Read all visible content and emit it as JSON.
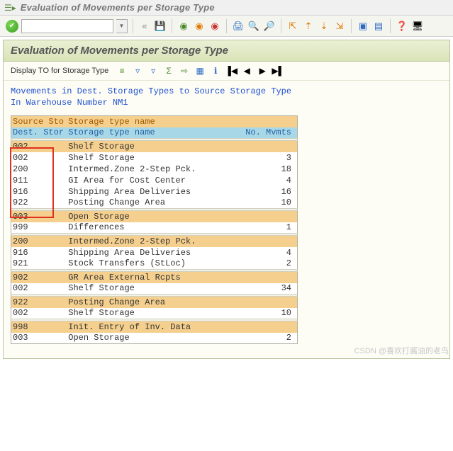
{
  "window": {
    "title": "Evaluation of Movements per Storage Type"
  },
  "page": {
    "heading": "Evaluation of Movements per Storage Type"
  },
  "toolbar2": {
    "display_to": "Display TO for Storage Type"
  },
  "info": {
    "line1": "Movements in Dest. Storage Types to Source Storage Type",
    "line2": "In Warehouse Number NM1"
  },
  "columns": {
    "src_code": "Source Sto",
    "src_name": "Storage type name",
    "dst_code": "Dest. Stor",
    "dst_name": "Storage type name",
    "mv": "No. Mvmts"
  },
  "groups": [
    {
      "hdr_code": "002",
      "hdr_name": "Shelf Storage",
      "rows": [
        {
          "code": "002",
          "name": "Shelf Storage",
          "mv": "3"
        },
        {
          "code": "200",
          "name": "Intermed.Zone 2-Step Pck.",
          "mv": "18"
        },
        {
          "code": "911",
          "name": "GI Area for Cost Center",
          "mv": "4"
        },
        {
          "code": "916",
          "name": "Shipping Area Deliveries",
          "mv": "16"
        },
        {
          "code": "922",
          "name": "Posting Change Area",
          "mv": "10"
        }
      ]
    },
    {
      "hdr_code": "003",
      "hdr_name": "Open Storage",
      "rows": [
        {
          "code": "999",
          "name": "Differences",
          "mv": "1"
        }
      ]
    },
    {
      "hdr_code": "200",
      "hdr_name": "Intermed.Zone 2-Step Pck.",
      "rows": [
        {
          "code": "916",
          "name": "Shipping Area Deliveries",
          "mv": "4"
        },
        {
          "code": "921",
          "name": "Stock Transfers (StLoc)",
          "mv": "2"
        }
      ]
    },
    {
      "hdr_code": "902",
      "hdr_name": "GR Area External Rcpts",
      "rows": [
        {
          "code": "002",
          "name": "Shelf Storage",
          "mv": "34"
        }
      ]
    },
    {
      "hdr_code": "922",
      "hdr_name": "Posting Change Area",
      "rows": [
        {
          "code": "002",
          "name": "Shelf Storage",
          "mv": "10"
        }
      ]
    },
    {
      "hdr_code": "998",
      "hdr_name": "Init. Entry of Inv. Data",
      "rows": [
        {
          "code": "003",
          "name": "Open Storage",
          "mv": "2"
        }
      ]
    }
  ],
  "watermark": "CSDN @喜欢打酱油的老鸟"
}
